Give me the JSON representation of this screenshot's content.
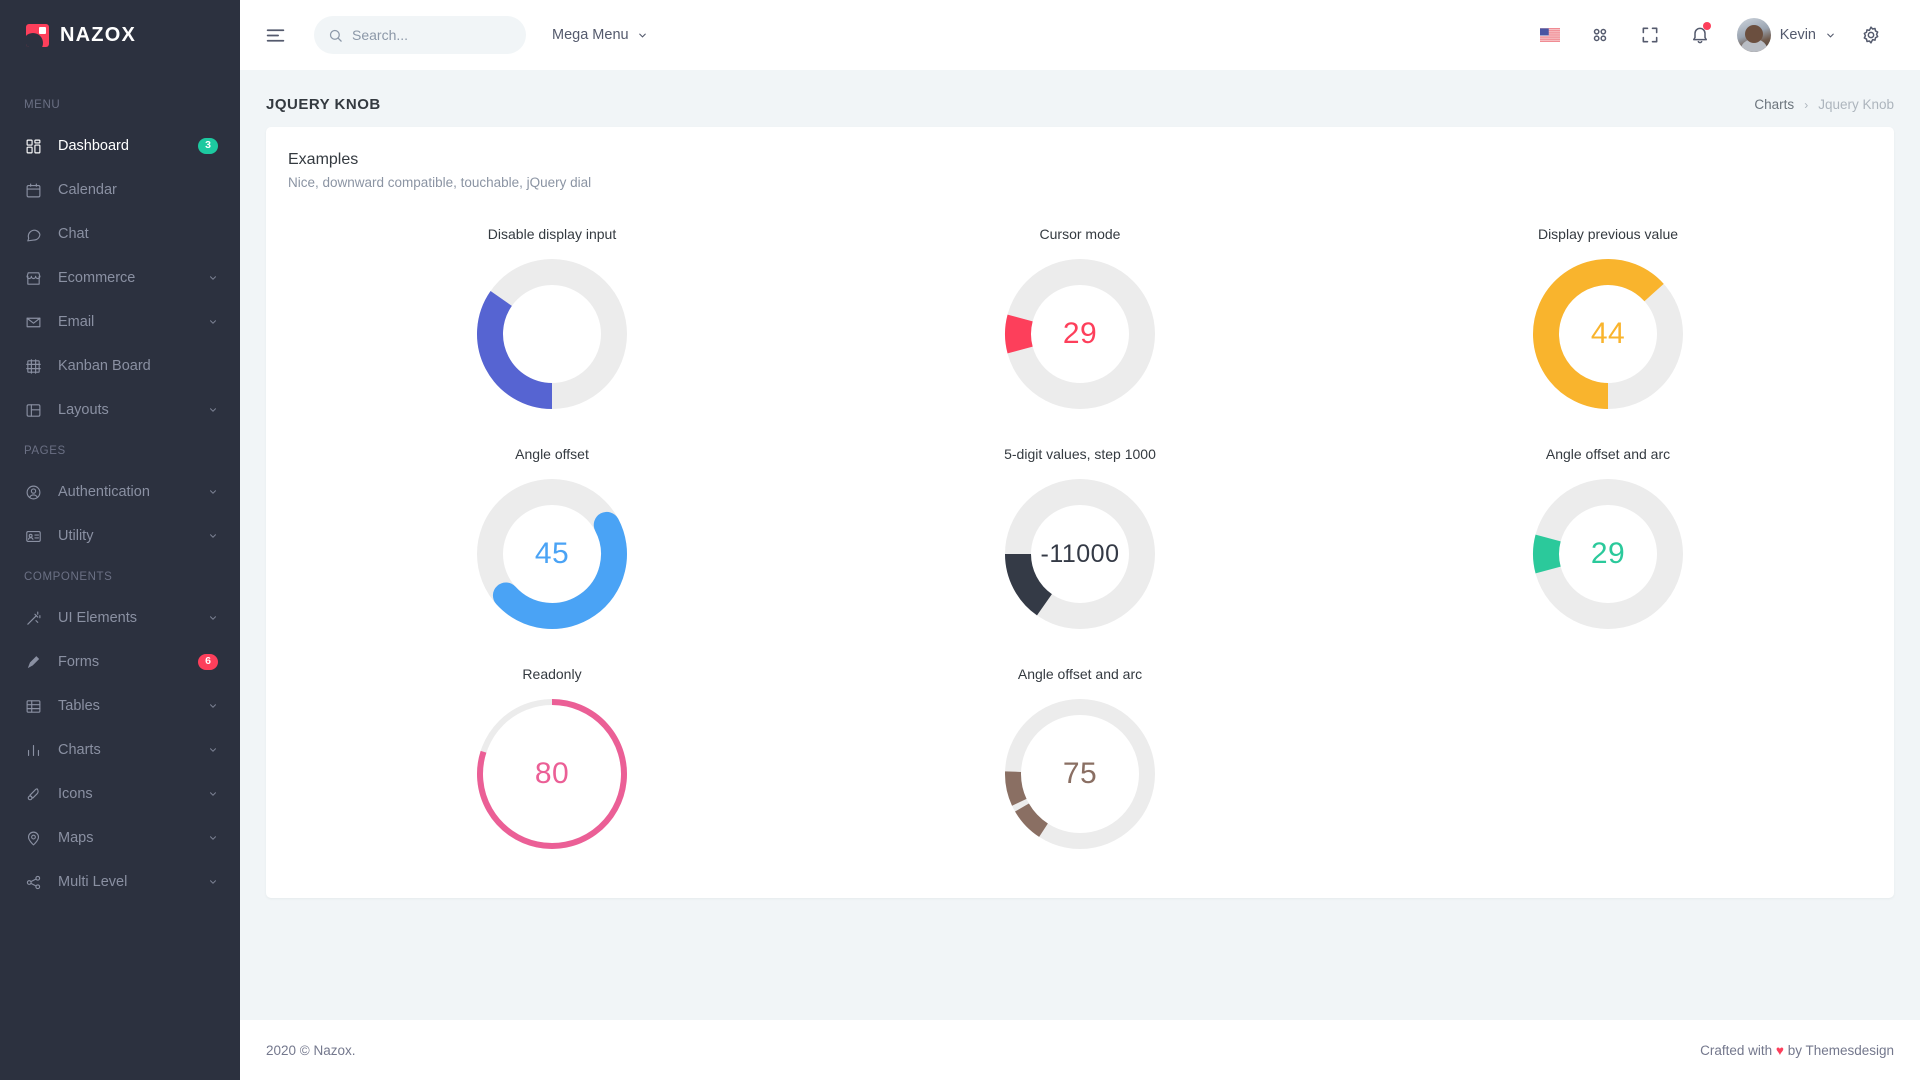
{
  "brand": {
    "name": "NAZOX",
    "icon": "nazox-logo-icon"
  },
  "sidebar": {
    "sections": [
      {
        "title": "MENU",
        "items": [
          {
            "label": "Dashboard",
            "icon": "dashboard-grid-icon",
            "badge": "3",
            "badge_color": "#1dc9a0",
            "active": true,
            "chevron": false
          },
          {
            "label": "Calendar",
            "icon": "calendar-icon",
            "active": false,
            "chevron": false
          },
          {
            "label": "Chat",
            "icon": "chat-bubble-icon",
            "active": false,
            "chevron": false
          },
          {
            "label": "Ecommerce",
            "icon": "store-icon",
            "active": false,
            "chevron": true
          },
          {
            "label": "Email",
            "icon": "mail-icon",
            "active": false,
            "chevron": true
          },
          {
            "label": "Kanban Board",
            "icon": "kanban-icon",
            "active": false,
            "chevron": false
          },
          {
            "label": "Layouts",
            "icon": "layout-icon",
            "active": false,
            "chevron": true
          }
        ]
      },
      {
        "title": "PAGES",
        "items": [
          {
            "label": "Authentication",
            "icon": "user-circle-icon",
            "active": false,
            "chevron": true
          },
          {
            "label": "Utility",
            "icon": "id-card-icon",
            "active": false,
            "chevron": true
          }
        ]
      },
      {
        "title": "COMPONENTS",
        "items": [
          {
            "label": "UI Elements",
            "icon": "wand-icon",
            "active": false,
            "chevron": true
          },
          {
            "label": "Forms",
            "icon": "pen-nib-icon",
            "badge": "6",
            "badge_color": "#fd3f5b",
            "active": false,
            "chevron": false
          },
          {
            "label": "Tables",
            "icon": "table-icon",
            "active": false,
            "chevron": true
          },
          {
            "label": "Charts",
            "icon": "bar-chart-icon",
            "active": false,
            "chevron": true
          },
          {
            "label": "Icons",
            "icon": "brush-icon",
            "active": false,
            "chevron": true
          },
          {
            "label": "Maps",
            "icon": "map-pin-icon",
            "active": false,
            "chevron": true
          },
          {
            "label": "Multi Level",
            "icon": "share-nodes-icon",
            "active": false,
            "chevron": true
          }
        ]
      }
    ]
  },
  "topbar": {
    "menu_toggle_icon": "hamburger-icon",
    "search": {
      "placeholder": "Search...",
      "value": "",
      "icon": "search-icon"
    },
    "mega_menu": {
      "label": "Mega Menu",
      "icon": "chevron-down-icon"
    },
    "language_flag": "us-flag-icon",
    "apps_icon": "apps-grid-icon",
    "fullscreen_icon": "fullscreen-icon",
    "notifications_icon": "bell-icon",
    "notification_indicator": true,
    "profile": {
      "name": "Kevin",
      "avatar": "user-avatar",
      "chevron": "chevron-down-icon"
    },
    "settings_icon": "gear-icon"
  },
  "page": {
    "title": "JQUERY KNOB",
    "breadcrumb": {
      "parent": "Charts",
      "separator": "›",
      "current": "Jquery Knob"
    }
  },
  "card": {
    "title": "Examples",
    "subtitle": "Nice, downward compatible, touchable, jQuery dial"
  },
  "chart_data": {
    "type": "pie",
    "title": "Examples",
    "subtitle": "Nice, downward compatible, touchable, jQuery dial",
    "knobs": [
      {
        "label": "Disable display input",
        "value": null,
        "display_value": "",
        "show_value": false,
        "color": "#5664d2",
        "track": "#ececec",
        "thickness": 26,
        "start_deg": 180,
        "end_deg": 305,
        "linecap": "butt",
        "max": 100
      },
      {
        "label": "Cursor mode",
        "value": 29,
        "display_value": "29",
        "show_value": true,
        "color": "#fd3f5b",
        "track": "#ececec",
        "thickness": 26,
        "start_deg": 255,
        "end_deg": 285,
        "linecap": "butt",
        "max": 100
      },
      {
        "label": "Display previous value",
        "value": 44,
        "display_value": "44",
        "show_value": true,
        "color": "#f9b42d",
        "track": "#ececec",
        "thickness": 26,
        "start_deg": 180,
        "end_deg": 408,
        "linecap": "butt",
        "max": 100
      },
      {
        "label": "Angle offset",
        "value": 45,
        "display_value": "45",
        "show_value": true,
        "color": "#4aa3f5",
        "track": "#ececec",
        "thickness": 26,
        "start_deg": 62,
        "end_deg": 228,
        "linecap": "round",
        "max": 100
      },
      {
        "label": "5-digit values, step 1000",
        "value": -11000,
        "display_value": "-11000",
        "show_value": true,
        "color": "#343a46",
        "track": "#ececec",
        "thickness": 26,
        "start_deg": 215,
        "end_deg": 270,
        "linecap": "butt",
        "max": 100
      },
      {
        "label": "Angle offset and arc",
        "value": 29,
        "display_value": "29",
        "show_value": true,
        "color": "#2bc99b",
        "track": "#ececec",
        "thickness": 26,
        "start_deg": 255,
        "end_deg": 285,
        "linecap": "butt",
        "max": 100
      },
      {
        "label": "Readonly",
        "value": 80,
        "display_value": "80",
        "show_value": true,
        "color": "#eb5f96",
        "track": "#ececec",
        "thickness": 6,
        "start_deg": 0,
        "end_deg": 288,
        "linecap": "butt",
        "max": 100
      },
      {
        "label": "Angle offset and arc",
        "value": 75,
        "display_value": "75",
        "show_value": true,
        "color": "#8a6f63",
        "track": "#ececec",
        "thickness": 16,
        "start_deg": 213,
        "end_deg": 272,
        "linecap": "butt",
        "max": 100,
        "segments": [
          [
            213,
            240
          ],
          [
            245,
            272
          ]
        ]
      }
    ]
  },
  "footer": {
    "left": "2020 © Nazox.",
    "right_prefix": "Crafted with",
    "heart": "♥",
    "right_suffix": "by Themesdesign"
  }
}
